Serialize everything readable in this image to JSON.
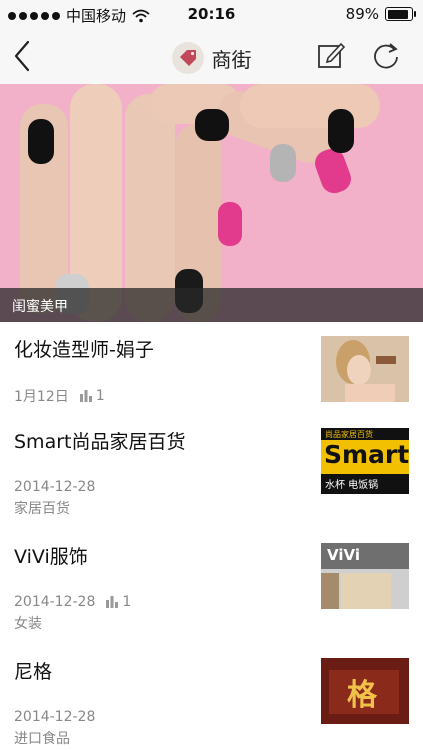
{
  "status_bar": {
    "carrier": "中国移动",
    "time": "20:16",
    "battery_text": "89%",
    "battery_level": 0.89,
    "wifi_icon": "wifi-icon"
  },
  "nav": {
    "title": "商街",
    "back_icon": "chevron-left-icon",
    "title_icon": "tag-icon",
    "edit_icon": "edit-icon",
    "refresh_icon": "refresh-icon"
  },
  "hero": {
    "caption": "闺蜜美甲"
  },
  "items": [
    {
      "title": "化妆造型师-娟子",
      "date": "1月12日",
      "views": "1",
      "category": ""
    },
    {
      "title": "Smart尚品家居百货",
      "date": "2014-12-28",
      "views": "",
      "category": "家居百货",
      "thumb_text": "Smart",
      "thumb_subtext": "水杯  电饭锅",
      "thumb_header": "尚品家居百货"
    },
    {
      "title": "ViVi服饰",
      "date": "2014-12-28",
      "views": "1",
      "category": "女装",
      "thumb_text": "ViVi"
    },
    {
      "title": "尼格",
      "date": "2014-12-28",
      "views": "",
      "category": "进口食品",
      "thumb_text": "格"
    }
  ],
  "colors": {
    "accent_tag": "#c0485a",
    "hero_bg": "#f0aac4"
  }
}
